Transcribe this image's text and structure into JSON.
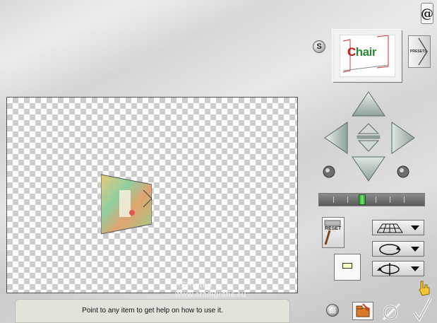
{
  "app": {
    "logo_glyph": "@",
    "s_label": "S"
  },
  "preview": {
    "thumb_text_left": "C",
    "thumb_text_right": "hair"
  },
  "presets": {
    "label": "PRESETS"
  },
  "canvas": {
    "watermark_line1": "PSPinted",
    "watermark_line2": "www.aradigrafie.eu"
  },
  "controls": {
    "reset_label": "RESET",
    "zoom_level": 0.4,
    "dropdowns": [
      {
        "icon": "perspective-grid-icon"
      },
      {
        "icon": "rotate-icon"
      },
      {
        "icon": "flip-icon"
      }
    ]
  },
  "status": {
    "text": "Point to any item to get help on how to use it."
  },
  "icons": [
    "grid-icon",
    "folder-icon",
    "cancel-icon",
    "checkmark-icon",
    "help-hand-icon"
  ]
}
